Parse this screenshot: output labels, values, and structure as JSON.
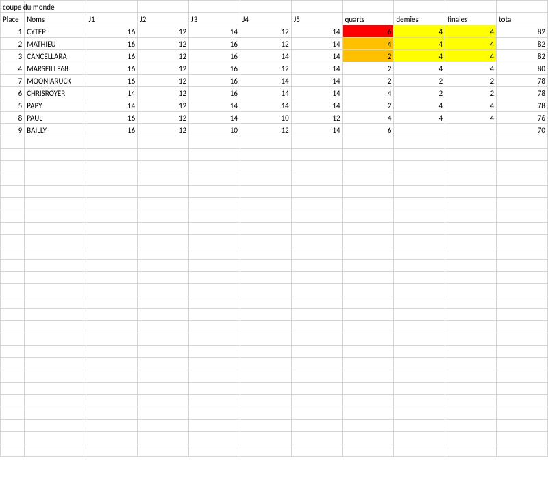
{
  "title": "coupe du monde",
  "headers": {
    "place": "Place",
    "noms": "Noms",
    "j1": "J1",
    "j2": "J2",
    "j3": "J3",
    "j4": "J4",
    "j5": "J5",
    "quarts": "quarts",
    "demies": "demies",
    "finales": "finales",
    "total": "total"
  },
  "rows": [
    {
      "place": 1,
      "nom": "CYTEP",
      "j1": 16,
      "j2": 12,
      "j3": 14,
      "j4": 12,
      "j5": 14,
      "quarts": 6,
      "demies": 4,
      "finales": 4,
      "total": 82,
      "hl": {
        "quarts": "red",
        "demies": "yellow",
        "finales": "yellow"
      }
    },
    {
      "place": 2,
      "nom": "MATHIEU",
      "j1": 16,
      "j2": 12,
      "j3": 16,
      "j4": 12,
      "j5": 14,
      "quarts": 4,
      "demies": 4,
      "finales": 4,
      "total": 82,
      "hl": {
        "quarts": "orange",
        "demies": "yellow",
        "finales": "yellow"
      }
    },
    {
      "place": 3,
      "nom": "CANCELLARA",
      "j1": 16,
      "j2": 12,
      "j3": 16,
      "j4": 14,
      "j5": 14,
      "quarts": 2,
      "demies": 4,
      "finales": 4,
      "total": 82,
      "hl": {
        "quarts": "orange",
        "demies": "yellow",
        "finales": "yellow"
      }
    },
    {
      "place": 4,
      "nom": "MARSEILLE68",
      "j1": 16,
      "j2": 12,
      "j3": 16,
      "j4": 12,
      "j5": 14,
      "quarts": 2,
      "demies": 4,
      "finales": 4,
      "total": 80,
      "hl": {}
    },
    {
      "place": 7,
      "nom": "MOONIARUCK",
      "j1": 16,
      "j2": 12,
      "j3": 16,
      "j4": 14,
      "j5": 14,
      "quarts": 2,
      "demies": 2,
      "finales": 2,
      "total": 78,
      "hl": {}
    },
    {
      "place": 6,
      "nom": "CHRISROYER",
      "j1": 14,
      "j2": 12,
      "j3": 16,
      "j4": 14,
      "j5": 14,
      "quarts": 4,
      "demies": 2,
      "finales": 2,
      "total": 78,
      "hl": {}
    },
    {
      "place": 5,
      "nom": "PAPY",
      "j1": 14,
      "j2": 12,
      "j3": 14,
      "j4": 14,
      "j5": 14,
      "quarts": 2,
      "demies": 4,
      "finales": 4,
      "total": 78,
      "hl": {}
    },
    {
      "place": 8,
      "nom": "PAUL",
      "j1": 16,
      "j2": 12,
      "j3": 14,
      "j4": 10,
      "j5": 12,
      "quarts": 4,
      "demies": 4,
      "finales": 4,
      "total": 76,
      "hl": {}
    },
    {
      "place": 9,
      "nom": "BAILLY",
      "j1": 16,
      "j2": 12,
      "j3": 10,
      "j4": 12,
      "j5": 14,
      "quarts": 6,
      "demies": "",
      "finales": "",
      "total": 70,
      "hl": {}
    }
  ],
  "blank_rows_after": 26
}
